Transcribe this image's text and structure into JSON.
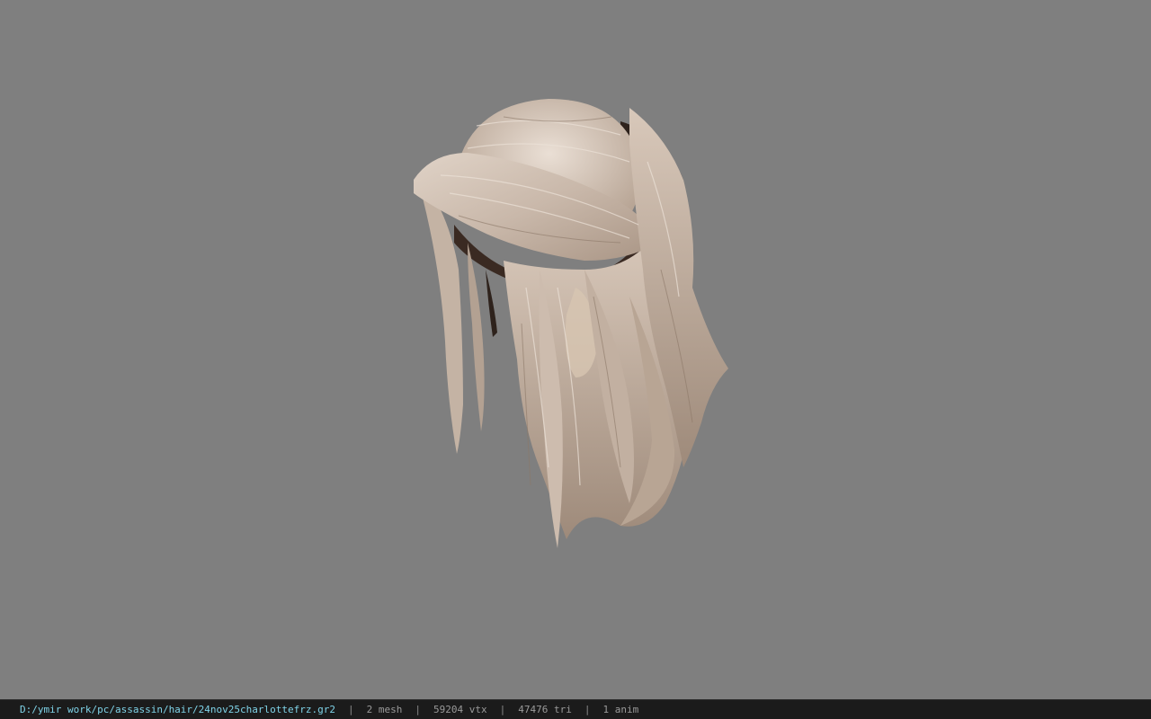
{
  "viewport": {
    "background": "#7f7f7f",
    "model": "hair mesh"
  },
  "status_bar": {
    "path": "D:/ymir work/pc/assassin/hair/24nov25charlottefrz.gr2",
    "separator": "|",
    "mesh": "2 mesh",
    "vtx": "59204 vtx",
    "tri": "47476 tri",
    "anim": "1 anim",
    "path_color": "#7fd3e8"
  }
}
